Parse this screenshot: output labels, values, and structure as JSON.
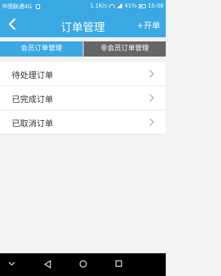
{
  "status_bar": {
    "carrier": "中国联通4G",
    "speed": "1.1K/s",
    "battery": "41%",
    "time": "15:08"
  },
  "header": {
    "title": "订单管理",
    "open_label": "+开单",
    "back_icon": "chevron-left-icon"
  },
  "tabs": [
    {
      "label": "会员订单管理",
      "active": true
    },
    {
      "label": "非会员订单管理",
      "active": false
    }
  ],
  "list": {
    "items": [
      {
        "label": "待处理订单"
      },
      {
        "label": "已完成订单"
      },
      {
        "label": "已取消订单"
      }
    ]
  },
  "colors": {
    "accent": "#3aa8e3",
    "inactive_tab": "#666666"
  }
}
